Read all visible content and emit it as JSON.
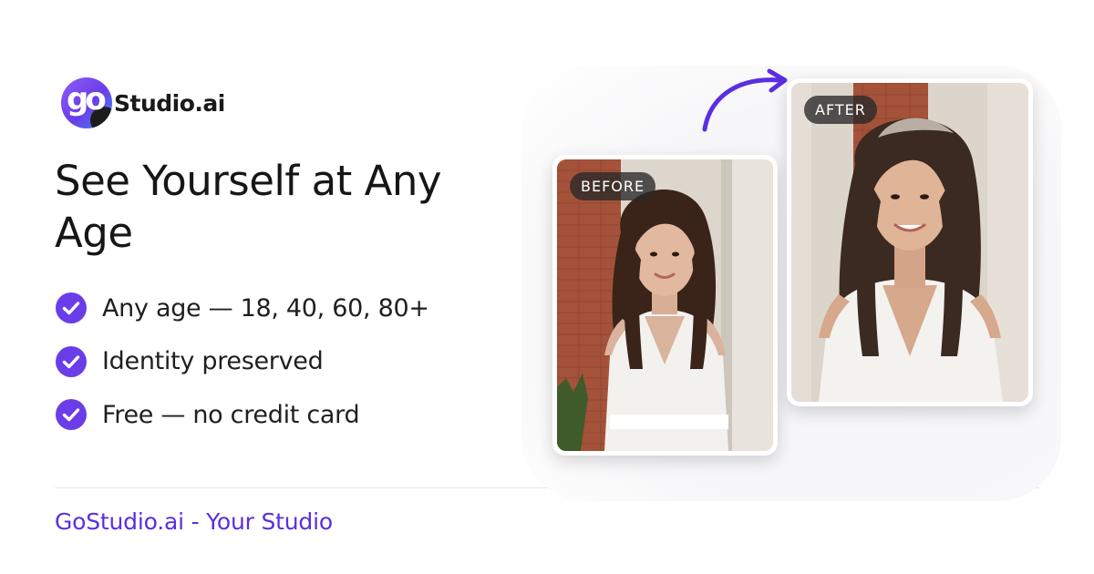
{
  "brand": {
    "logo_glyph": "go",
    "name": "Studio.ai",
    "accent_color": "#6a3de8"
  },
  "headline": "See Yourself at Any Age",
  "features": [
    {
      "text": "Any age — 18, 40, 60, 80+",
      "icon": "check-circle-icon"
    },
    {
      "text": "Identity preserved",
      "icon": "check-circle-icon"
    },
    {
      "text": "Free — no credit card",
      "icon": "check-circle-icon"
    }
  ],
  "comparison": {
    "before_label": "BEFORE",
    "after_label": "AFTER",
    "arrow_icon": "curved-arrow-icon"
  },
  "footer": {
    "link_text": "GoStudio.ai - Your Studio",
    "link_color": "#5b2ee0"
  }
}
